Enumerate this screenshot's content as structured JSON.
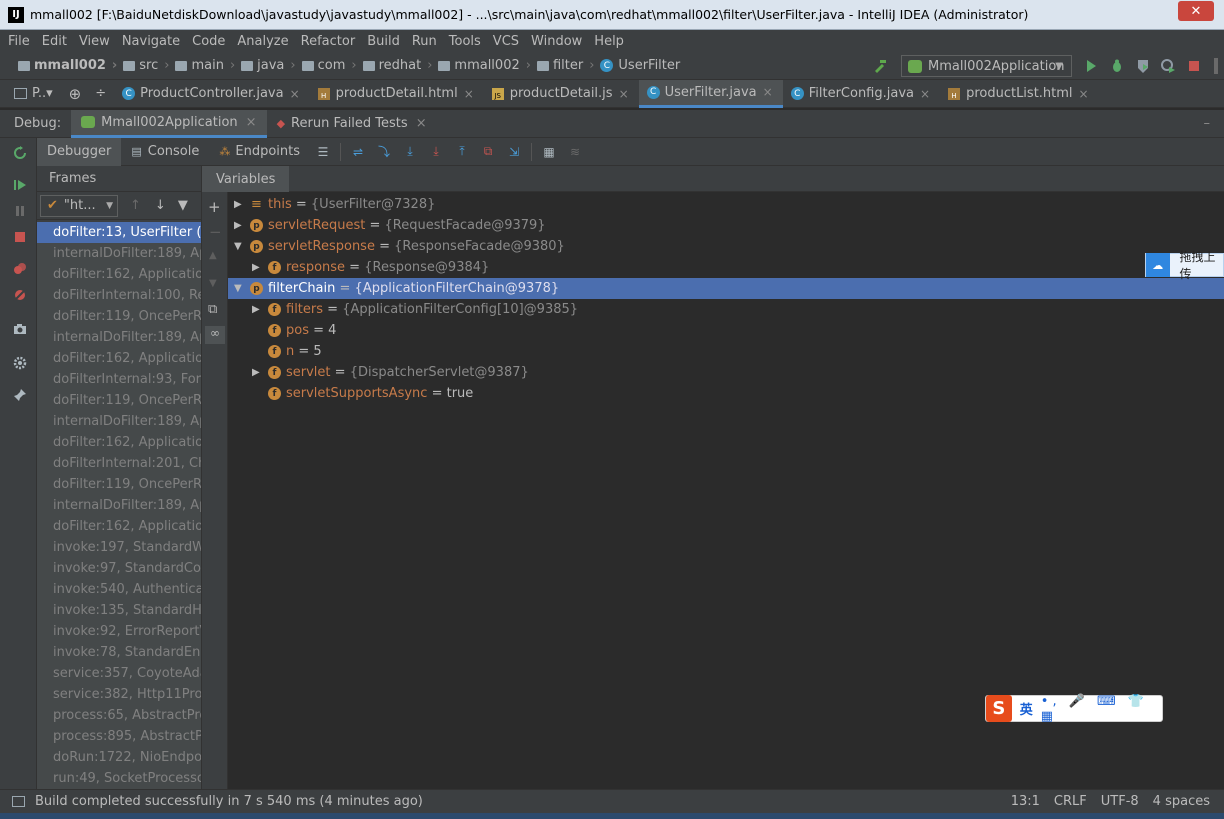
{
  "window": {
    "title": "mmall002 [F:\\BaiduNetdiskDownload\\javastudy\\javastudy\\mmall002] - ...\\src\\main\\java\\com\\redhat\\mmall002\\filter\\UserFilter.java - IntelliJ IDEA (Administrator)",
    "close": "✕"
  },
  "menu": [
    "File",
    "Edit",
    "View",
    "Navigate",
    "Code",
    "Analyze",
    "Refactor",
    "Build",
    "Run",
    "Tools",
    "VCS",
    "Window",
    "Help"
  ],
  "breadcrumb": [
    "mmall002",
    "src",
    "main",
    "java",
    "com",
    "redhat",
    "mmall002",
    "filter",
    "UserFilter"
  ],
  "run_config": "Mmall002Application",
  "tabs": {
    "project": "P..▾",
    "files": [
      "ProductController.java",
      "productDetail.html",
      "productDetail.js",
      "UserFilter.java",
      "FilterConfig.java",
      "productList.html"
    ]
  },
  "debug": {
    "label": "Debug:",
    "sessions": [
      "Mmall002Application",
      "Rerun Failed Tests"
    ]
  },
  "debugger_tabs": [
    "Debugger",
    "Console",
    "Endpoints"
  ],
  "frames": {
    "header": "Frames",
    "thread": "\"ht...",
    "list": [
      "doFilter:13, UserFilter (co",
      "internalDoFilter:189, Appli",
      "doFilter:162, ApplicationFi",
      "doFilterInternal:100, Requ",
      "doFilter:119, OncePerReq",
      "internalDoFilter:189, Appli",
      "doFilter:162, ApplicationFi",
      "doFilterInternal:93, FormC",
      "doFilter:119, OncePerReq",
      "internalDoFilter:189, Appli",
      "doFilter:162, ApplicationFi",
      "doFilterInternal:201, Chara",
      "doFilter:119, OncePerReq",
      "internalDoFilter:189, Appli",
      "doFilter:162, ApplicationFi",
      "invoke:197, StandardWrap",
      "invoke:97, StandardConte",
      "invoke:540, Authenticator",
      "invoke:135, StandardHost",
      "invoke:92, ErrorReportVa",
      "invoke:78, StandardEngin",
      "service:357, CoyoteAdapte",
      "service:382, Http11Proces",
      "process:65, AbstractProce",
      "process:895, AbstractProt",
      "doRun:1722, NioEndpoint",
      "run:49, SocketProcessorB"
    ]
  },
  "variables": {
    "header": "Variables",
    "rows": [
      {
        "name": "this",
        "eq": " = ",
        "value": "{UserFilter@7328}",
        "icon": "eq",
        "expander": "▶"
      },
      {
        "name": "servletRequest",
        "eq": " = ",
        "value": "{RequestFacade@9379}",
        "icon": "p",
        "expander": "▶"
      },
      {
        "name": "servletResponse",
        "eq": " = ",
        "value": "{ResponseFacade@9380}",
        "icon": "p",
        "expander": "▼"
      },
      {
        "name": "response",
        "eq": " = ",
        "value": "{Response@9384}",
        "icon": "f",
        "expander": "▶"
      },
      {
        "name": "filterChain",
        "eq": " = ",
        "value": "{ApplicationFilterChain@9378}",
        "icon": "p",
        "expander": "▼"
      },
      {
        "name": "filters",
        "eq": " = ",
        "value": "{ApplicationFilterConfig[10]@9385}",
        "icon": "f",
        "expander": "▶"
      },
      {
        "name": "pos",
        "eq": " = ",
        "value": "4",
        "icon": "f",
        "expander": ""
      },
      {
        "name": "n",
        "eq": " = ",
        "value": "5",
        "icon": "f",
        "expander": ""
      },
      {
        "name": "servlet",
        "eq": " = ",
        "value": "{DispatcherServlet@9387}",
        "icon": "f",
        "expander": "▶"
      },
      {
        "name": "servletSupportsAsync",
        "eq": " = ",
        "value": "true",
        "icon": "f",
        "expander": ""
      }
    ]
  },
  "status": {
    "message": "Build completed successfully in 7 s 540 ms (4 minutes ago)",
    "position": "13:1",
    "line_sep": "CRLF",
    "encoding": "UTF-8",
    "indent": "4 spaces"
  },
  "overlays": {
    "baidu_upload": "拖拽上传",
    "ime_lang": "英",
    "ime_glyphs": "•, 🎤 ⌨ 👕 ▦"
  }
}
